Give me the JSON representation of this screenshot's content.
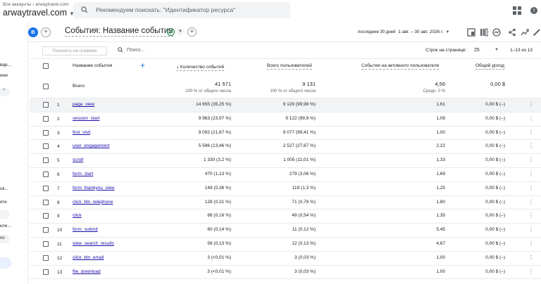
{
  "topbar": {
    "breadcrumb": "Все аккаунты › arwaytravel.com",
    "property": "arwaytravel.com",
    "search_placeholder": "Рекомендуем поискать: \"Идентификатор ресурса\""
  },
  "leftrail": {
    "fragments": [
      "вар...",
      "ени",
      "ок...",
      "ете",
      "кли...",
      "по"
    ]
  },
  "report": {
    "avatar_letter": "В",
    "title": "События: Название события",
    "period_label": "последние 30 дней",
    "period_value": "1 авг. – 30 авг. 2026 г."
  },
  "toolbar": {
    "show_on_chart": "Показать на графике",
    "search_placeholder": "Поиск...",
    "rows_per_page_label": "Строк на странице:",
    "rows_per_page_value": "25",
    "pager": "1–13 из 13"
  },
  "columns": {
    "event_name": "Название события",
    "event_count": "Количество событий",
    "total_users": "Всего пользователей",
    "events_per_user": "События на активного пользователя",
    "revenue": "Общий доход"
  },
  "totals": {
    "label": "Всего",
    "event_count": "41 571",
    "event_count_sub": "100 % от общего числа",
    "total_users": "9 131",
    "total_users_sub": "100 % от общего числа",
    "events_per_user": "4,56",
    "events_per_user_sub": "Средн. 0 %",
    "revenue": "0,00 $"
  },
  "rows": [
    {
      "idx": "1",
      "name": "page_view",
      "count": "14 655 (35,25 %)",
      "users": "9 129 (99,98 %)",
      "per_user": "1,61",
      "revenue": "0,00 $ (–)"
    },
    {
      "idx": "2",
      "name": "session_start",
      "count": "9 963 (23,97 %)",
      "users": "9 122 (99,9 %)",
      "per_user": "1,09",
      "revenue": "0,00 $ (–)"
    },
    {
      "idx": "3",
      "name": "first_visit",
      "count": "9 092 (21,87 %)",
      "users": "9 077 (99,41 %)",
      "per_user": "1,00",
      "revenue": "0,00 $ (–)"
    },
    {
      "idx": "4",
      "name": "user_engagement",
      "count": "5 596 (13,46 %)",
      "users": "2 527 (27,67 %)",
      "per_user": "2,22",
      "revenue": "0,00 $ (–)"
    },
    {
      "idx": "5",
      "name": "scroll",
      "count": "1 330 (3,2 %)",
      "users": "1 005 (11,01 %)",
      "per_user": "1,33",
      "revenue": "0,00 $ (–)"
    },
    {
      "idx": "6",
      "name": "form_start",
      "count": "470 (1,13 %)",
      "users": "279 (3,06 %)",
      "per_user": "1,69",
      "revenue": "0,00 $ (–)"
    },
    {
      "idx": "7",
      "name": "form_thankyou_view",
      "count": "149 (0,36 %)",
      "users": "119 (1,3 %)",
      "per_user": "1,25",
      "revenue": "0,00 $ (–)"
    },
    {
      "idx": "8",
      "name": "click_btn_telephone",
      "count": "128 (0,31 %)",
      "users": "71 (0,78 %)",
      "per_user": "1,80",
      "revenue": "0,00 $ (–)"
    },
    {
      "idx": "9",
      "name": "click",
      "count": "66 (0,16 %)",
      "users": "49 (0,54 %)",
      "per_user": "1,35",
      "revenue": "0,00 $ (–)"
    },
    {
      "idx": "10",
      "name": "form_submit",
      "count": "60 (0,14 %)",
      "users": "11 (0,12 %)",
      "per_user": "5,45",
      "revenue": "0,00 $ (–)"
    },
    {
      "idx": "11",
      "name": "view_search_results",
      "count": "56 (0,13 %)",
      "users": "12 (0,13 %)",
      "per_user": "4,67",
      "revenue": "0,00 $ (–)"
    },
    {
      "idx": "12",
      "name": "click_btn_email",
      "count": "3 (<0,01 %)",
      "users": "3 (0,03 %)",
      "per_user": "1,00",
      "revenue": "0,00 $ (–)"
    },
    {
      "idx": "13",
      "name": "file_download",
      "count": "3 (<0,01 %)",
      "users": "3 (0,03 %)",
      "per_user": "1,00",
      "revenue": "0,00 $ (–)"
    }
  ],
  "colors": {
    "accent": "#1a73e8",
    "link": "#1a0dab",
    "ok": "#188038"
  }
}
